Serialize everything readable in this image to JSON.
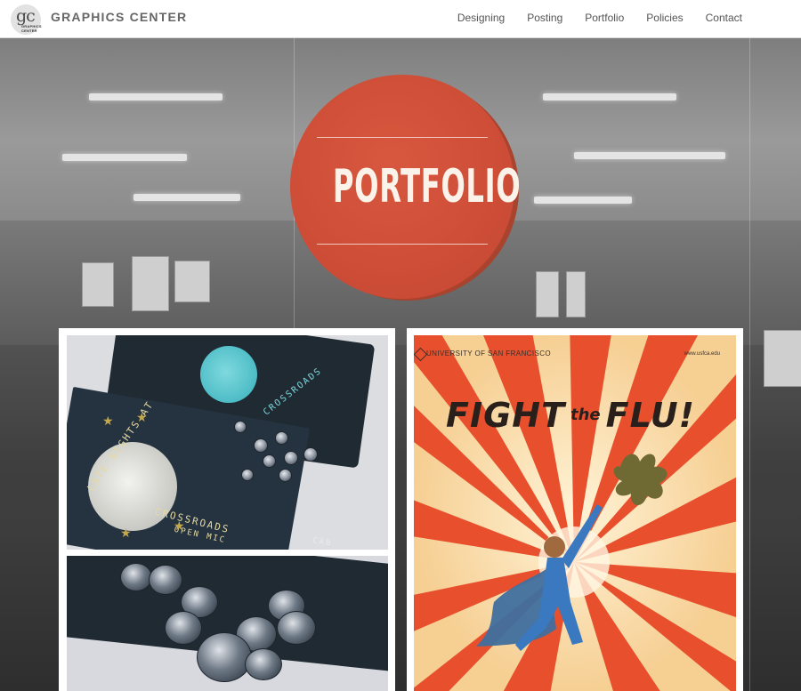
{
  "header": {
    "logo_mark": "gc",
    "logo_sub": "GRAPHICS CENTER",
    "brand": "GRAPHICS CENTER",
    "nav": [
      "Designing",
      "Posting",
      "Portfolio",
      "Policies",
      "Contact"
    ]
  },
  "hero": {
    "badge_text": "PORTFOLIO",
    "badge_color": "#cd4d37"
  },
  "tiles": {
    "left": {
      "flyer_text_1": "LATE NIGHTS AT",
      "flyer_text_2": "CROSSROADS",
      "flyer_text_3": "OPEN MIC",
      "cab_mark": "CAB"
    },
    "right": {
      "org": "UNIVERSITY OF SAN FRANCISCO",
      "url": "www.usfca.edu",
      "title_1": "FIGHT",
      "title_2": "the",
      "title_3": "FLU!"
    }
  },
  "icons": [
    "logo-icon",
    "usf-seal-icon",
    "germ-icon",
    "superhero-figure-icon"
  ]
}
